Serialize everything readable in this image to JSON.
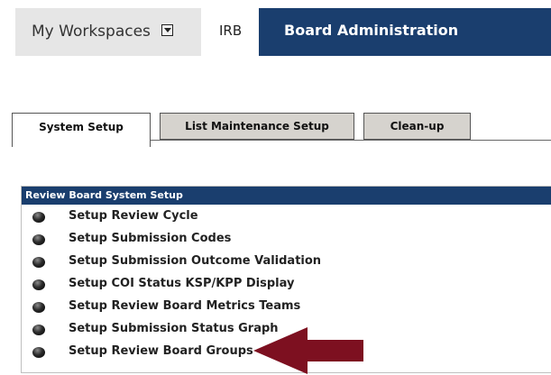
{
  "top_nav": {
    "workspaces_label": "My Workspaces",
    "irb_label": "IRB",
    "board_admin_label": "Board Administration"
  },
  "subtabs": [
    "System Setup",
    "List Maintenance Setup",
    "Clean-up"
  ],
  "panel": {
    "header": "Review Board System Setup",
    "items": [
      "Setup Review Cycle",
      "Setup Submission Codes",
      "Setup Submission Outcome Validation",
      "Setup COI Status KSP/KPP Display",
      "Setup Review Board Metrics Teams",
      "Setup Submission Status Graph",
      "Setup Review Board Groups"
    ]
  },
  "colors": {
    "nav_dark_blue": "#1a3e6e",
    "workspace_tab_bg": "#e6e6e6",
    "inactive_tab_bg": "#d6d3ce",
    "arrow": "#7d1020"
  }
}
